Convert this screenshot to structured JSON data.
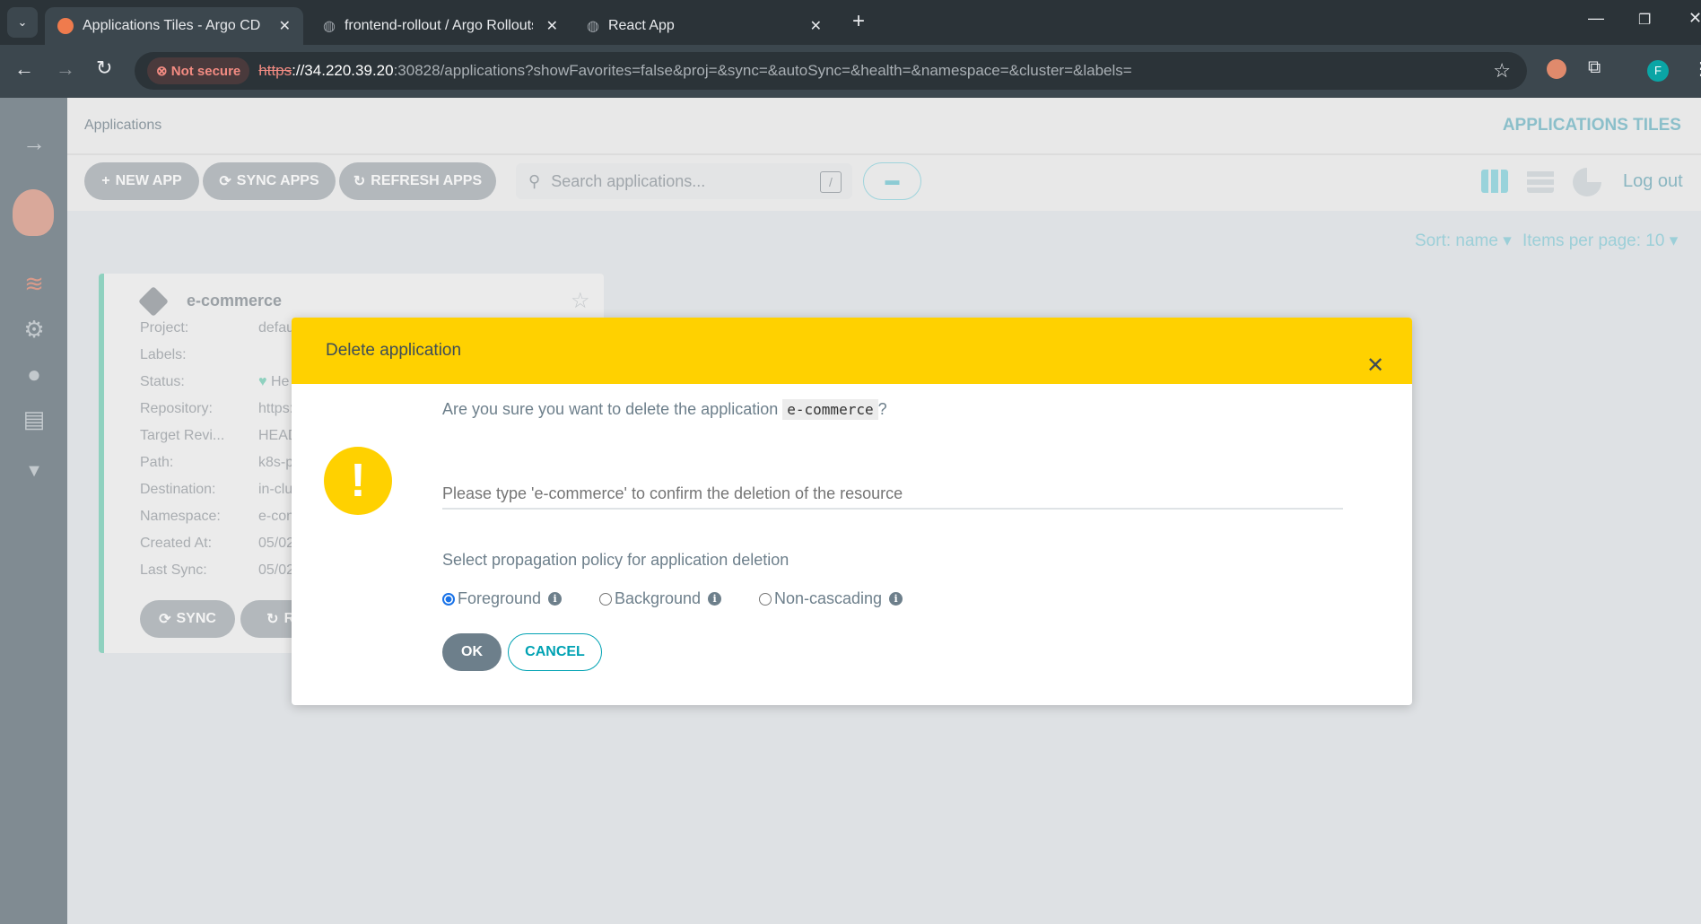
{
  "browser": {
    "tabs": [
      {
        "title": "Applications Tiles - Argo CD"
      },
      {
        "title": "frontend-rollout / Argo Rollouts"
      },
      {
        "title": "React App"
      }
    ],
    "not_secure": "Not secure",
    "url_scheme": "https",
    "url_host": "://34.220.39.20",
    "url_rest": ":30828/applications?showFavorites=false&proj=&sync=&autoSync=&health=&namespace=&cluster=&labels=",
    "profile_initial": "F"
  },
  "header": {
    "breadcrumb": "Applications",
    "title": "APPLICATIONS TILES"
  },
  "toolbar": {
    "new_app": "NEW APP",
    "sync_apps": "SYNC APPS",
    "refresh_apps": "REFRESH APPS",
    "search_placeholder": "Search applications...",
    "search_shortcut": "/",
    "logout": "Log out"
  },
  "sort": {
    "sort_label": "Sort: name",
    "items_label": "Items per page: 10"
  },
  "card": {
    "name": "e-commerce",
    "rows": [
      {
        "label": "Project:",
        "value": "defau"
      },
      {
        "label": "Labels:",
        "value": ""
      },
      {
        "label": "Status:",
        "value": "He"
      },
      {
        "label": "Repository:",
        "value": "https:"
      },
      {
        "label": "Target Revi...",
        "value": "HEAD"
      },
      {
        "label": "Path:",
        "value": "k8s-pl"
      },
      {
        "label": "Destination:",
        "value": "in-clus"
      },
      {
        "label": "Namespace:",
        "value": "e-com"
      },
      {
        "label": "Created At:",
        "value": "05/02"
      },
      {
        "label": "Last Sync:",
        "value": "05/02"
      }
    ],
    "sync": "SYNC",
    "refresh": "RE"
  },
  "dialog": {
    "title": "Delete application",
    "question_prefix": "Are you sure you want to delete the application",
    "app_name": "e-commerce",
    "question_suffix": "?",
    "confirm_placeholder": "Please type 'e-commerce' to confirm the deletion of the resource",
    "policy_label": "Select propagation policy for application deletion",
    "options": [
      {
        "label": "Foreground",
        "selected": true
      },
      {
        "label": "Background",
        "selected": false
      },
      {
        "label": "Non-cascading",
        "selected": false
      }
    ],
    "ok": "OK",
    "cancel": "CANCEL"
  },
  "colors": {
    "warning": "#ffd100",
    "accent": "#00a2b3"
  }
}
